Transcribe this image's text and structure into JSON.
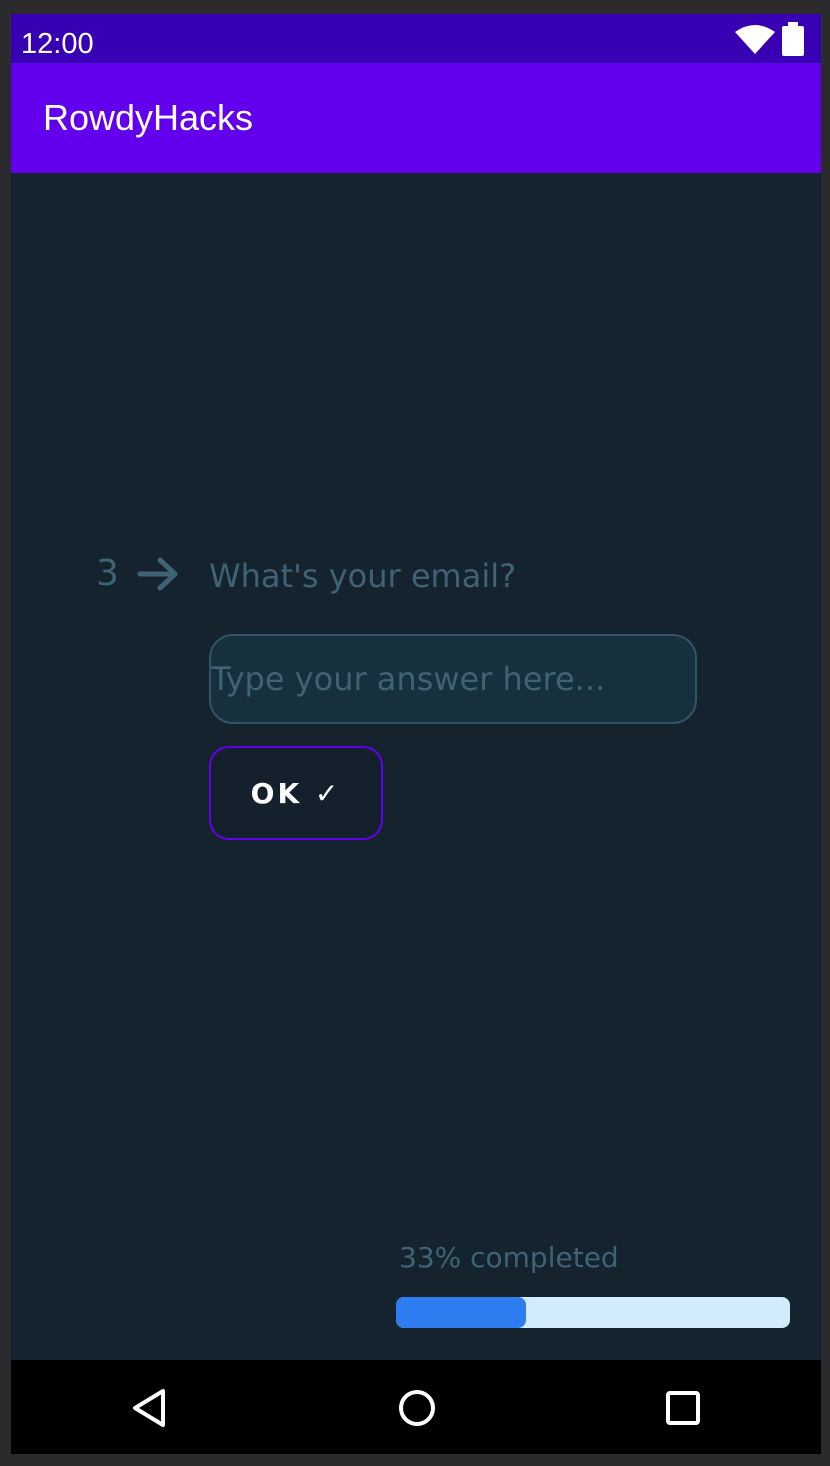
{
  "status_bar": {
    "time": "12:00",
    "icons": [
      "wifi-icon",
      "battery-icon"
    ]
  },
  "app_bar": {
    "title": "RowdyHacks",
    "color": "#6200ee"
  },
  "question": {
    "number": "3",
    "arrow_icon": "arrow-right-icon",
    "text": "What's your email?"
  },
  "answer": {
    "placeholder": "Type your answer here...",
    "value": ""
  },
  "ok_button": {
    "label": "OK ✓"
  },
  "progress": {
    "label": "33% completed",
    "fraction": 0.33,
    "fill_color": "#2e7df0",
    "track_color": "#d2ecfb"
  },
  "nav_bar": {
    "icons": [
      "back-icon",
      "home-icon",
      "recents-icon"
    ]
  },
  "colors": {
    "background": "#15232e",
    "status_bar": "#3700b3",
    "muted_text": "#3f6275"
  }
}
